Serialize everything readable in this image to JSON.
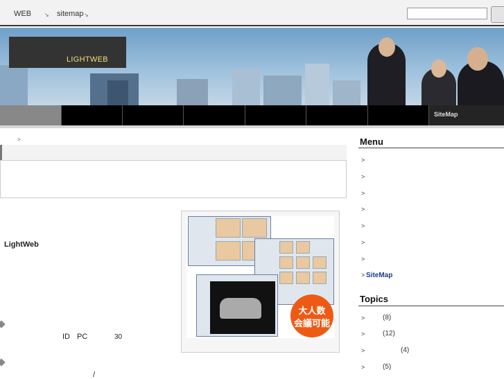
{
  "topbar": {
    "web_label": "WEB",
    "sitemap_label": "sitemap",
    "search": {
      "value": "",
      "placeholder": ""
    }
  },
  "header": {
    "logo_text": "LIGHTWEB"
  },
  "nav": {
    "sitemap_label": "SiteMap"
  },
  "breadcrumb": {
    "arrow": ">"
  },
  "main": {
    "product_name": "LightWeb",
    "product_badge": {
      "line1": "大人数",
      "line2": "会議可能"
    },
    "line_id": "ID",
    "line_pc": "PC",
    "line_30": "30",
    "slash": "/"
  },
  "sidebar": {
    "menu_heading": "Menu",
    "menu_arrow": ">",
    "sitemap_link": "SiteMap",
    "topics_heading": "Topics",
    "topics": [
      {
        "count": "(8)"
      },
      {
        "count": "(12)"
      },
      {
        "count": "(4)"
      },
      {
        "count": "(5)"
      }
    ]
  },
  "colors": {
    "nav_background": "#000000",
    "logo_box": "#333333",
    "logo_text": "#f0e070",
    "sitemap_link": "#1a3d8a",
    "badge": "#ee5a14"
  },
  "icons": {
    "search_button": "search-button",
    "arrow": "chevron-right-icon",
    "bullet": "diamond-bullet-icon"
  }
}
